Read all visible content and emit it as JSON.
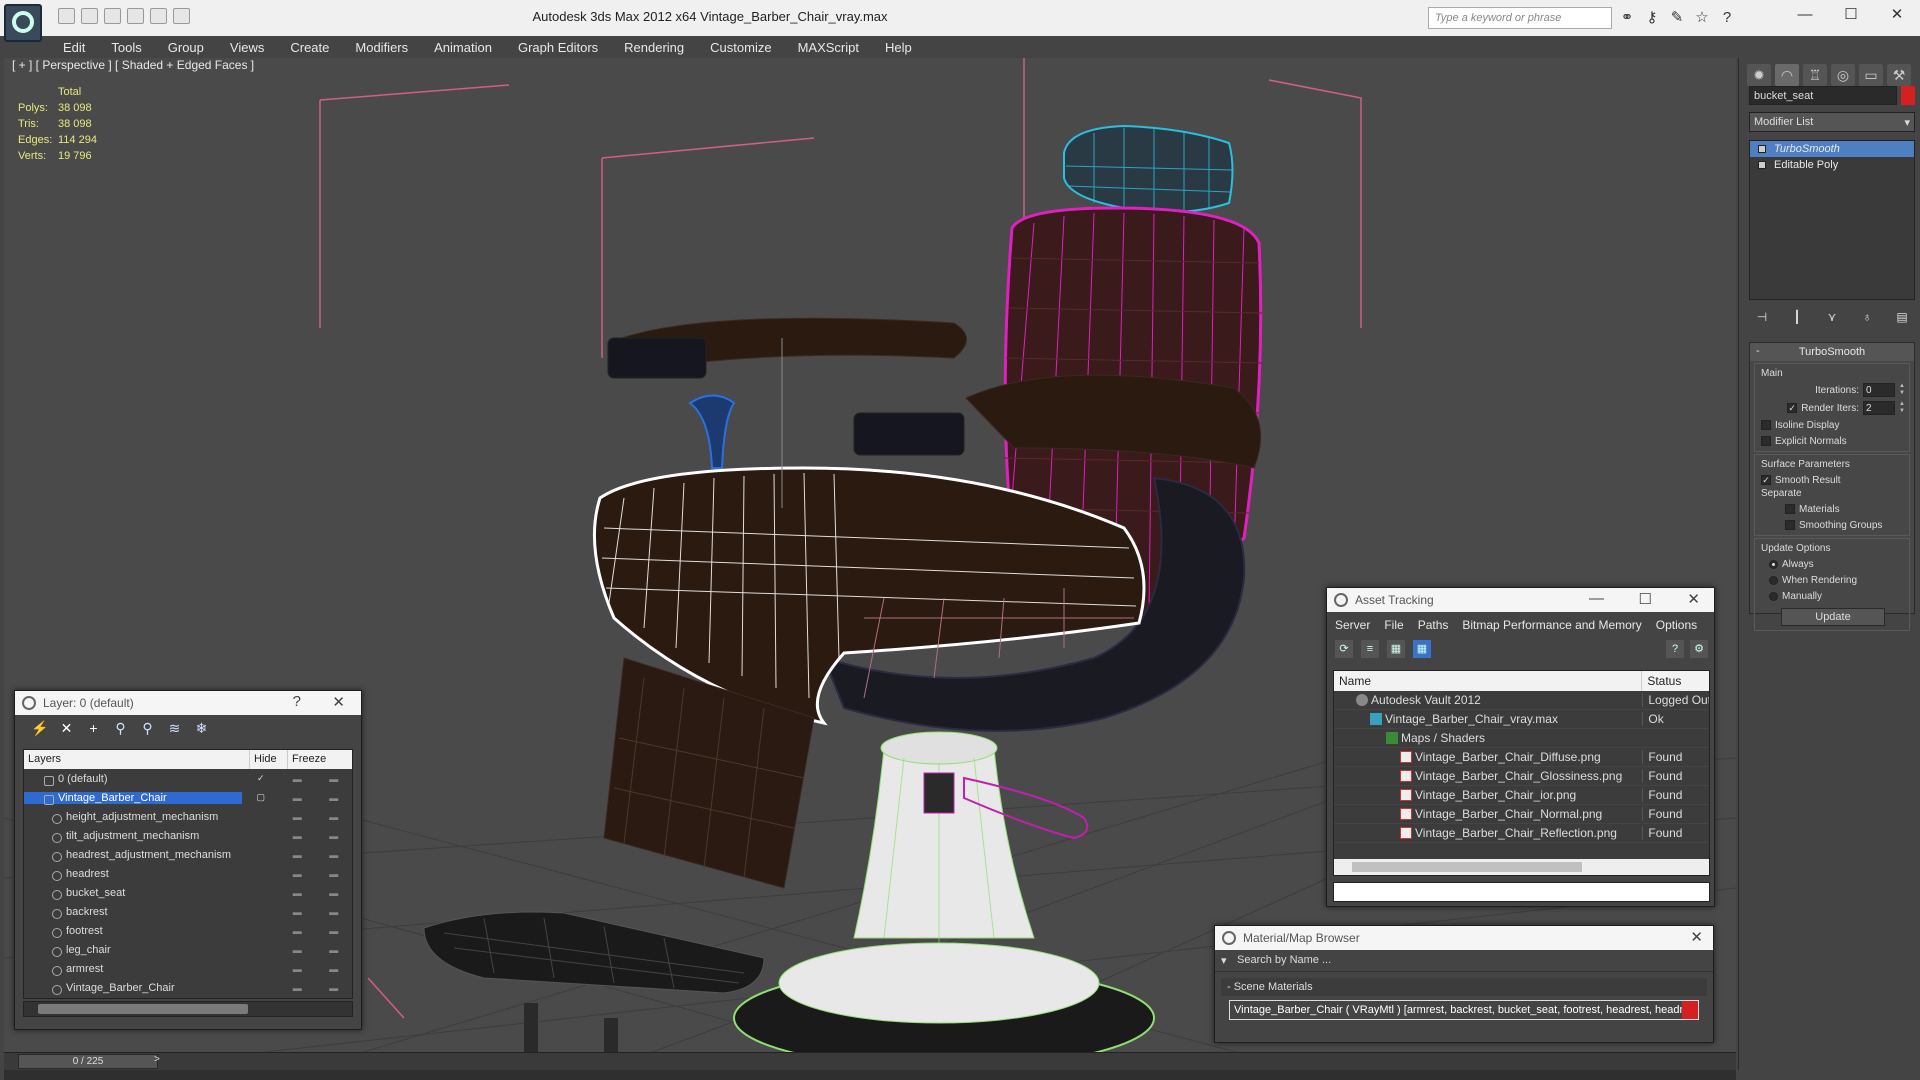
{
  "app": {
    "title": "Autodesk 3ds Max  2012 x64        Vintage_Barber_Chair_vray.max",
    "search_placeholder": "Type a keyword or phrase",
    "window_controls": [
      "—",
      "☐",
      "✕"
    ]
  },
  "menu": [
    "Edit",
    "Tools",
    "Group",
    "Views",
    "Create",
    "Modifiers",
    "Animation",
    "Graph Editors",
    "Rendering",
    "Customize",
    "MAXScript",
    "Help"
  ],
  "viewport": {
    "label": "[ + ] [ Perspective ] [ Shaded + Edged Faces ]",
    "stats_header": "Total",
    "stats": [
      {
        "label": "Polys:",
        "value": "38 098"
      },
      {
        "label": "Tris:",
        "value": "38 098"
      },
      {
        "label": "Edges:",
        "value": "114 294"
      },
      {
        "label": "Verts:",
        "value": "19 796"
      }
    ]
  },
  "command_panel": {
    "object_name": "bucket_seat",
    "object_color": "#d42020",
    "modifier_list_label": "Modifier List",
    "stack": [
      {
        "label": "TurboSmooth",
        "selected": true
      },
      {
        "label": "Editable Poly",
        "selected": false
      }
    ],
    "rollout_title": "TurboSmooth",
    "main_group": "Main",
    "iterations_label": "Iterations:",
    "iterations_value": "0",
    "render_iters_label": "Render Iters:",
    "render_iters_value": "2",
    "isoline_label": "Isoline Display",
    "explicit_normals_label": "Explicit Normals",
    "surface_group": "Surface Parameters",
    "smooth_result_label": "Smooth Result",
    "separate_label": "Separate",
    "materials_label": "Materials",
    "smoothing_groups_label": "Smoothing Groups",
    "update_group": "Update Options",
    "always_label": "Always",
    "when_rendering_label": "When Rendering",
    "manually_label": "Manually",
    "update_button": "Update"
  },
  "layer_window": {
    "title": "Layer: 0 (default)",
    "help": "?",
    "close": "✕",
    "col_layers": "Layers",
    "col_hide": "Hide",
    "col_freeze": "Freeze",
    "rows": [
      {
        "name": "0 (default)",
        "type": "layer",
        "selected": false
      },
      {
        "name": "Vintage_Barber_Chair",
        "type": "layer",
        "selected": true
      },
      {
        "name": "height_adjustment_mechanism",
        "type": "object",
        "selected": false
      },
      {
        "name": "tilt_adjustment_mechanism",
        "type": "object",
        "selected": false
      },
      {
        "name": "headrest_adjustment_mechanism",
        "type": "object",
        "selected": false
      },
      {
        "name": "headrest",
        "type": "object",
        "selected": false
      },
      {
        "name": "bucket_seat",
        "type": "object",
        "selected": false
      },
      {
        "name": "backrest",
        "type": "object",
        "selected": false
      },
      {
        "name": "footrest",
        "type": "object",
        "selected": false
      },
      {
        "name": "leg_chair",
        "type": "object",
        "selected": false
      },
      {
        "name": "armrest",
        "type": "object",
        "selected": false
      },
      {
        "name": "Vintage_Barber_Chair",
        "type": "object",
        "selected": false
      }
    ]
  },
  "asset_window": {
    "title": "Asset Tracking",
    "menu": [
      "Server",
      "File",
      "Paths",
      "Bitmap Performance and Memory",
      "Options"
    ],
    "col_name": "Name",
    "col_status": "Status",
    "rows": [
      {
        "name": "Autodesk Vault 2012",
        "status": "Logged Out ...",
        "indent": 1
      },
      {
        "name": "Vintage_Barber_Chair_vray.max",
        "status": "Ok",
        "indent": 2
      },
      {
        "name": "Maps / Shaders",
        "status": "",
        "indent": 3
      },
      {
        "name": "Vintage_Barber_Chair_Diffuse.png",
        "status": "Found",
        "indent": 4
      },
      {
        "name": "Vintage_Barber_Chair_Glossiness.png",
        "status": "Found",
        "indent": 4
      },
      {
        "name": "Vintage_Barber_Chair_ior.png",
        "status": "Found",
        "indent": 4
      },
      {
        "name": "Vintage_Barber_Chair_Normal.png",
        "status": "Found",
        "indent": 4
      },
      {
        "name": "Vintage_Barber_Chair_Reflection.png",
        "status": "Found",
        "indent": 4
      }
    ]
  },
  "material_window": {
    "title": "Material/Map Browser",
    "search_placeholder": "Search by Name ...",
    "section": "- Scene Materials",
    "item": "Vintage_Barber_Chair  ( VRayMtl ) [armrest, backrest, bucket_seat, footrest, headrest, headrest_adjustment_mechanism, heig..."
  },
  "timeline": {
    "frame_label": "0 / 225",
    "next": ">"
  }
}
